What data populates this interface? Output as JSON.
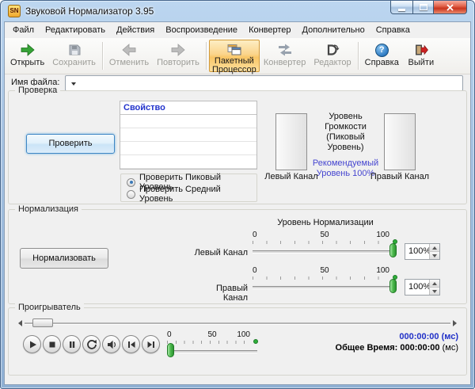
{
  "window": {
    "title": "Звуковой Нормализатор 3.95",
    "icon_text": "SN"
  },
  "menu": {
    "items": [
      "Файл",
      "Редактировать",
      "Действия",
      "Воспроизведение",
      "Конвертер",
      "Дополнительно",
      "Справка"
    ]
  },
  "toolbar": {
    "items": [
      {
        "label": "Открыть"
      },
      {
        "label": "Сохранить"
      },
      {
        "label": "Отменить"
      },
      {
        "label": "Повторить"
      },
      {
        "label": "Пакетный Процессор"
      },
      {
        "label": "Конвертер"
      },
      {
        "label": "Редактор"
      },
      {
        "label": "Справка"
      },
      {
        "label": "Выйти"
      }
    ]
  },
  "icons": {
    "help_glyph": "?"
  },
  "filename": {
    "label": "Имя файла:",
    "value": ""
  },
  "check": {
    "group_title": "Проверка",
    "check_button": "Проверить",
    "table_header": "Свойство",
    "volume_line1": "Уровень Громкости",
    "volume_line2": "(Пиковый Уровень)",
    "recommended_line1": "Рекомендуемый",
    "recommended_line2": "Уровень 100%",
    "left_channel_label": "Левый Канал",
    "right_channel_label": "Правый Канал",
    "radio_peak": "Проверить Пиковый Уровень",
    "radio_average": "Проверить Средний Уровень"
  },
  "normalize": {
    "group_title": "Нормализация",
    "normalize_button": "Нормализовать",
    "level_title": "Уровень Нормализации",
    "left_channel_label": "Левый Канал",
    "right_channel_label": "Правый Канал",
    "ticks": [
      "0",
      "50",
      "100"
    ],
    "left_value": "100%",
    "right_value": "100%"
  },
  "player": {
    "group_title": "Проигрыватель",
    "ticks": [
      "0",
      "50",
      "100"
    ],
    "current_time": "000:00:00",
    "current_unit": "(мс)",
    "total_label": "Общее Время:",
    "total_time": "000:00:00",
    "total_unit": "(мс)"
  }
}
